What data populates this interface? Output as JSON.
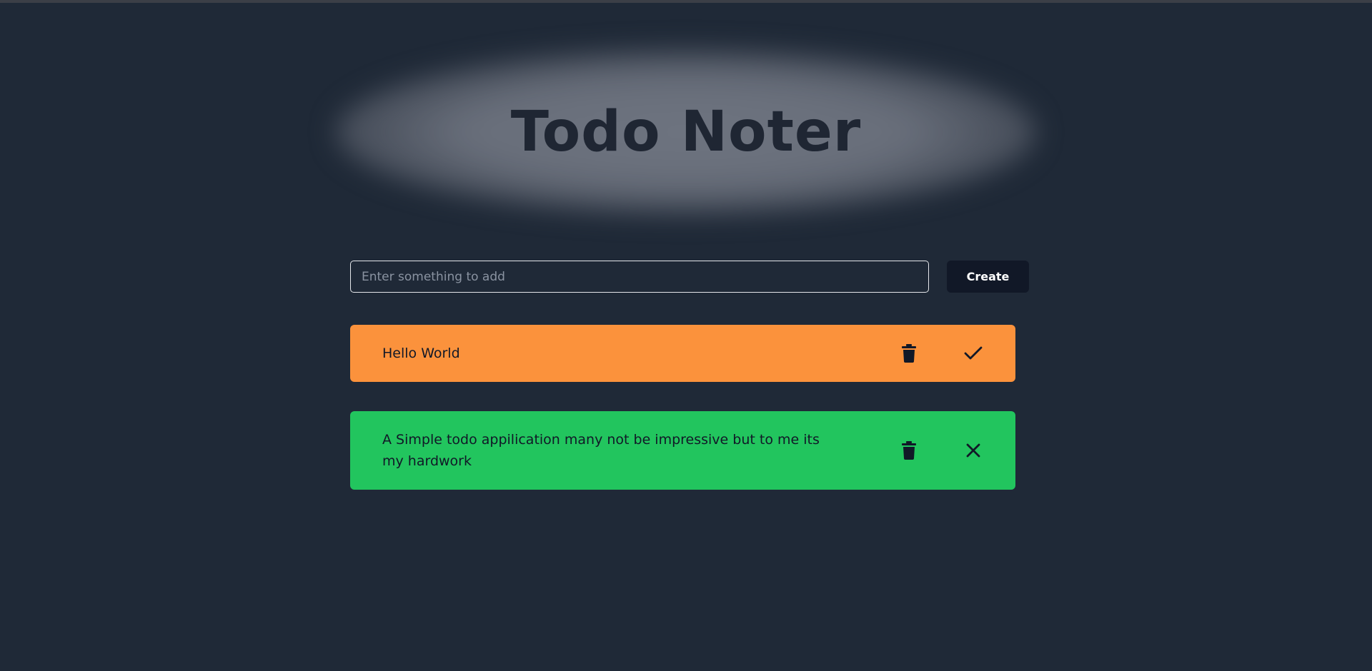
{
  "app": {
    "title": "Todo Noter"
  },
  "form": {
    "input_placeholder": "Enter something to add",
    "input_value": "",
    "create_label": "Create"
  },
  "todos": [
    {
      "text": "Hello World",
      "status": "pending",
      "color": "#fb923c",
      "delete_icon": "trash-icon",
      "toggle_icon": "check-icon"
    },
    {
      "text": "A Simple todo appilication many not be impressive but to me its my hardwork",
      "status": "done",
      "color": "#22c55e",
      "delete_icon": "trash-icon",
      "toggle_icon": "close-icon"
    }
  ],
  "colors": {
    "background": "#1f2937",
    "button": "#111827",
    "title": "#1f2633"
  }
}
